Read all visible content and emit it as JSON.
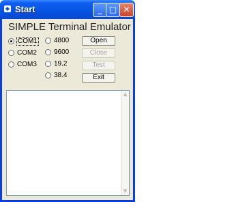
{
  "window": {
    "title": "Start"
  },
  "titlebar": {
    "minimize": "_",
    "maximize": "□",
    "close": "✕"
  },
  "heading": "SIMPLE Terminal Emulator",
  "ports": [
    {
      "label": "COM1",
      "selected": true
    },
    {
      "label": "COM2",
      "selected": false
    },
    {
      "label": "COM3",
      "selected": false
    }
  ],
  "speeds": [
    {
      "label": "4800",
      "selected": false
    },
    {
      "label": "9600",
      "selected": false
    },
    {
      "label": "19.2",
      "selected": false
    },
    {
      "label": "38.4",
      "selected": false
    }
  ],
  "buttons": {
    "open": "Open",
    "close": "Close",
    "test": "Test",
    "exit": "Exit"
  },
  "output": {
    "text": ""
  }
}
